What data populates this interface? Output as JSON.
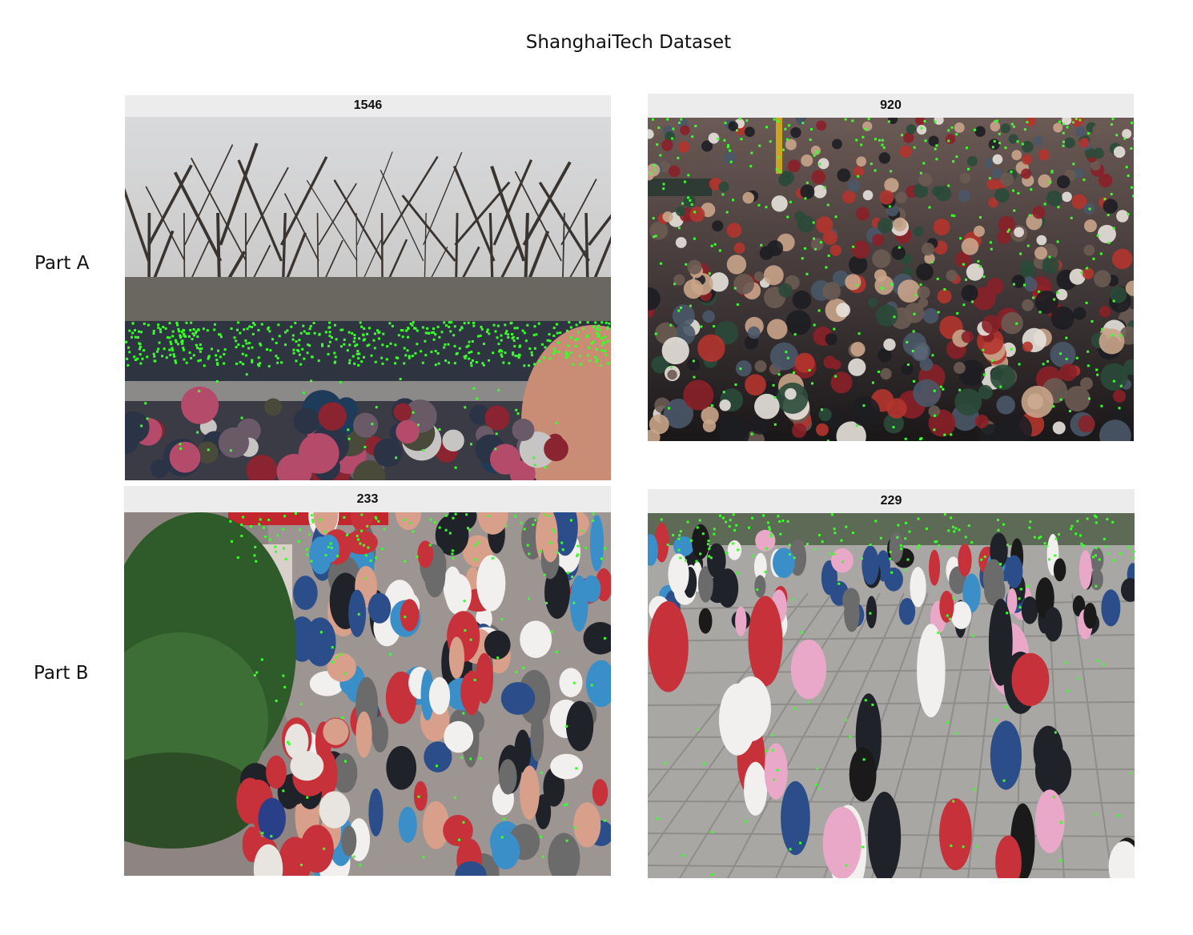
{
  "title": "ShanghaiTech Dataset",
  "rows": [
    {
      "label": "Part A"
    },
    {
      "label": "Part B"
    }
  ],
  "panels": [
    {
      "count": "1546",
      "scene": "park-parade-crowd"
    },
    {
      "count": "920",
      "scene": "dense-stadium-crowd"
    },
    {
      "count": "233",
      "scene": "street-crowd-with-tree"
    },
    {
      "count": "229",
      "scene": "plaza-crowd"
    }
  ],
  "colors": {
    "annotation_dot": "#39ff2a",
    "header_bg": "#ececec"
  }
}
